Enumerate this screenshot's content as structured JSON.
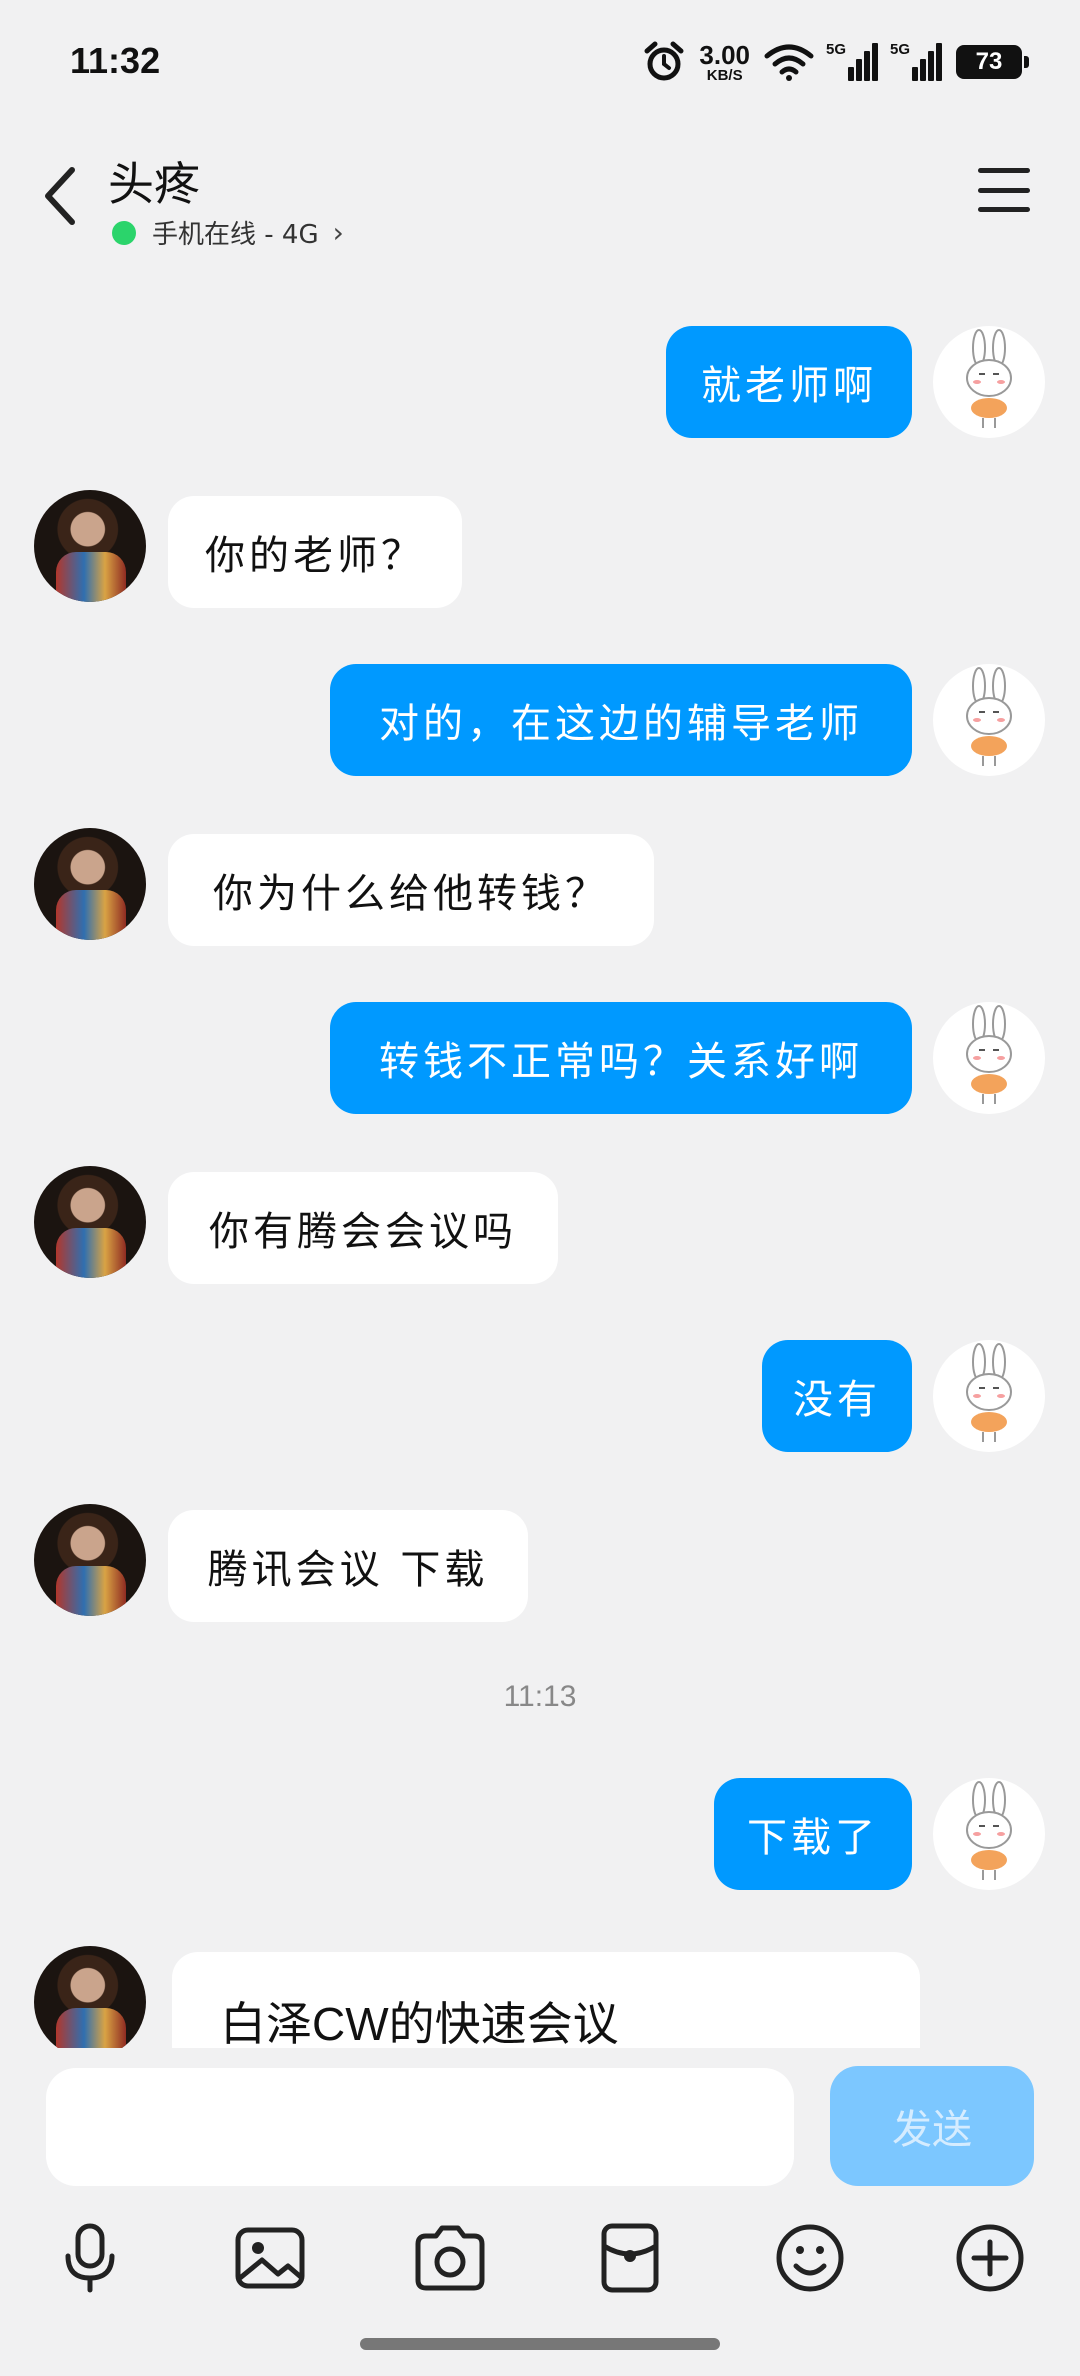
{
  "status_bar": {
    "time": "11:32",
    "net_speed_value": "3.00",
    "net_speed_unit": "KB/S",
    "signal_1_label": "5G",
    "signal_2_label": "5G",
    "battery": "73"
  },
  "header": {
    "title": "头疼",
    "status": "手机在线 - 4G",
    "status_chevron": "›"
  },
  "messages": [
    {
      "side": "out",
      "text": "就老师啊"
    },
    {
      "side": "in",
      "text": "你的老师？"
    },
    {
      "side": "out",
      "text": "对的，在这边的辅导老师"
    },
    {
      "side": "in",
      "text": "你为什么给他转钱？"
    },
    {
      "side": "out",
      "text": "转钱不正常吗？关系好啊"
    },
    {
      "side": "in",
      "text": "你有腾会会议吗"
    },
    {
      "side": "out",
      "text": "没有"
    },
    {
      "side": "in",
      "text": "腾讯会议 下载"
    },
    {
      "side": "out",
      "text": "下载了"
    }
  ],
  "timestamp": "11:13",
  "meeting_card": {
    "title": "白泽CW的快速会议"
  },
  "input": {
    "value": "",
    "send_label": "发送"
  },
  "toolbar_icons": [
    "microphone-icon",
    "image-icon",
    "camera-icon",
    "red-packet-icon",
    "emoji-icon",
    "plus-icon"
  ],
  "colors": {
    "outgoing_bubble": "#0099ff",
    "incoming_bubble": "#ffffff",
    "online_dot": "#2bd46b",
    "send_button": "#7cc7ff",
    "background": "#f1f1f2"
  }
}
